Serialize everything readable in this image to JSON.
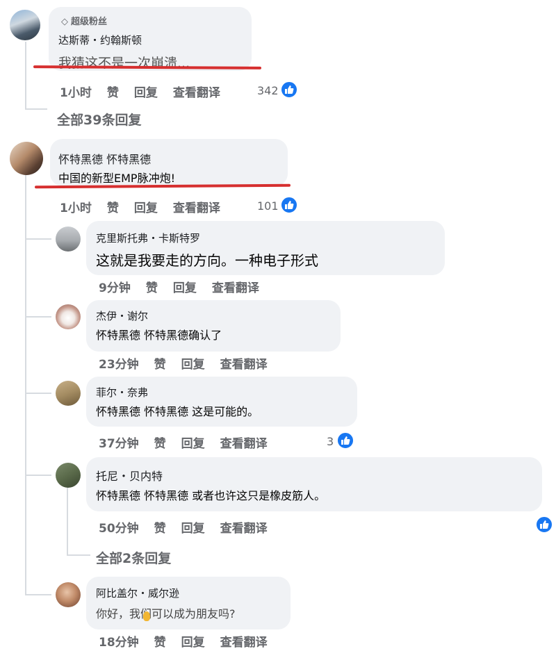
{
  "c1": {
    "badge": "超级粉丝",
    "name": "达斯蒂・约翰斯顿",
    "text": "我猜这不是一次崩溃...",
    "time": "1小时",
    "like": "赞",
    "reply": "回复",
    "translate": "查看翻译",
    "likes": "342",
    "all_replies": "全部39条回复"
  },
  "c2": {
    "name": "怀特黑德 怀特黑德",
    "text": "中国的新型EMP脉冲炮!",
    "time": "1小时",
    "like": "赞",
    "reply": "回复",
    "translate": "查看翻译",
    "likes": "101"
  },
  "r1": {
    "name": "克里斯托弗・卡斯特罗",
    "text": "这就是我要走的方向。一种电子形式",
    "time": "9分钟",
    "like": "赞",
    "reply": "回复",
    "translate": "查看翻译"
  },
  "r2": {
    "name": "杰伊・谢尔",
    "text": "怀特黑德 怀特黑德确认了",
    "time": "23分钟",
    "like": "赞",
    "reply": "回复",
    "translate": "查看翻译"
  },
  "r3": {
    "name": "菲尔・奈弗",
    "text": "怀特黑德 怀特黑德 这是可能的。",
    "time": "37分钟",
    "like": "赞",
    "reply": "回复",
    "translate": "查看翻译",
    "likes": "3"
  },
  "r4": {
    "name": "托尼・贝内特",
    "text": "怀特黑德 怀特黑德 或者也许这只是橡皮筋人。",
    "time": "50分钟",
    "like": "赞",
    "reply": "回复",
    "translate": "查看翻译"
  },
  "all_replies_2": "全部2条回复",
  "r5": {
    "name": "阿比盖尔・威尔逊",
    "text": "你好，我们可以成为朋友吗?",
    "time": "18分钟",
    "like": "赞",
    "reply": "回复",
    "translate": "查看翻译"
  },
  "colors": {
    "accent": "#1877f2",
    "underline": "#d62f2f",
    "bubble": "#f0f2f5",
    "muted": "#65676b"
  }
}
